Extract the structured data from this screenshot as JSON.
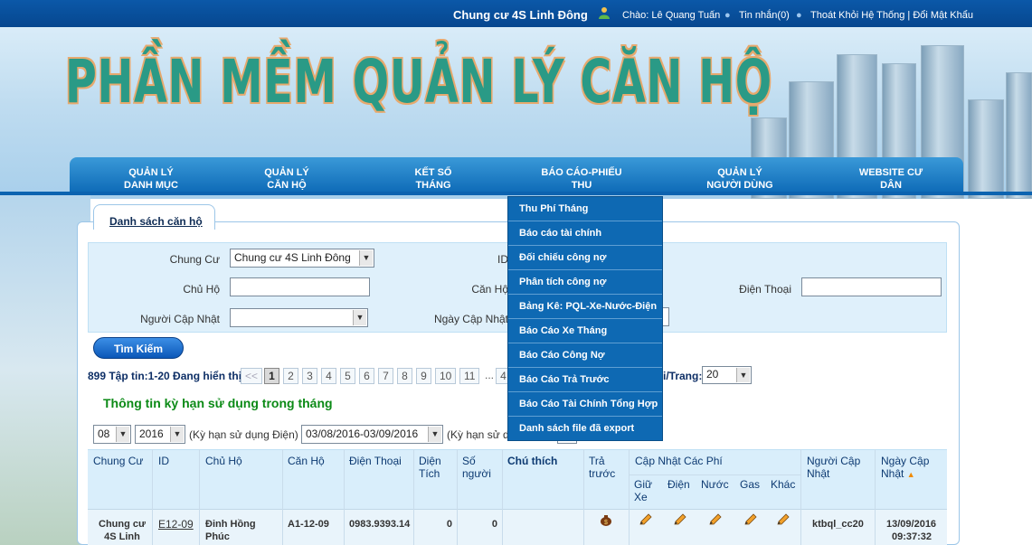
{
  "topbar": {
    "site_name": "Chung cư 4S Linh Đông",
    "greeting": "Chào: Lê Quang Tuấn",
    "messages": "Tin nhắn(0)",
    "links": "Thoát Khỏi Hệ Thống | Đổi Mật Khẩu"
  },
  "banner": {
    "title": "PHẦN MỀM QUẢN LÝ CĂN HỘ"
  },
  "nav": [
    {
      "line1": "QUẢN LÝ",
      "line2": "DANH MỤC"
    },
    {
      "line1": "QUẢN LÝ",
      "line2": "CĂN HỘ"
    },
    {
      "line1": "KẾT SỔ",
      "line2": "THÁNG"
    },
    {
      "line1": "BÁO CÁO-PHIẾU",
      "line2": "THU"
    },
    {
      "line1": "QUẢN LÝ",
      "line2": "NGƯỜI DÙNG"
    },
    {
      "line1": "WEBSITE CƯ",
      "line2": "DÂN"
    }
  ],
  "tab": {
    "label": "Danh sách căn hộ"
  },
  "form": {
    "chung_cu_label": "Chung Cư",
    "chung_cu_value": "Chung cư 4S Linh Đông",
    "id_label": "ID",
    "chu_ho_label": "Chủ Hộ",
    "can_ho_label": "Căn Hộ",
    "dien_thoai_label": "Điện Thoại",
    "nguoi_cap_nhat_label": "Người Cập Nhật",
    "ngay_cap_nhat_label": "Ngày Cập Nhật",
    "search_button": "Tìm Kiếm"
  },
  "pager": {
    "info": "899 Tập tin:1-20 Đang hiển thị",
    "prev": "<<",
    "pages": [
      "1",
      "2",
      "3",
      "4",
      "5",
      "6",
      "7",
      "8",
      "9",
      "10",
      "11",
      "...",
      "4"
    ],
    "per_page_label": "i/Trang:",
    "per_page_value": "20"
  },
  "section": {
    "title": "Thông tin kỳ hạn sử dụng trong tháng",
    "month": "08",
    "year": "2016",
    "ky_han_dien_label": "(Kỳ hạn sử dụng Điện)",
    "ky_han_dien_value": "03/08/2016-03/09/2016",
    "ky_han_label2": "(Kỳ hạn sử d"
  },
  "table": {
    "headers": {
      "chung_cu": "Chung Cư",
      "id": "ID",
      "chu_ho": "Chủ Hộ",
      "can_ho": "Căn Hộ",
      "dien_thoai": "Điện Thoại",
      "dien_tich": "Diện Tích",
      "so_nguoi": "Số người",
      "chu_thich": "Chú thích",
      "tra_truoc": "Trả trước",
      "cap_nhat_cac_phi": "Cập Nhật Các Phí",
      "giu_xe": "Giữ Xe",
      "dien": "Điện",
      "nuoc": "Nước",
      "gas": "Gas",
      "khac": "Khác",
      "nguoi_cap_nhat": "Người Cập Nhật",
      "ngay_cap_nhat": "Ngày Cập Nhật"
    },
    "rows": [
      {
        "chung_cu": "Chung cư 4S Linh",
        "id": "E12-09",
        "chu_ho": "Đinh Hồng Phúc",
        "can_ho": "A1-12-09",
        "dien_thoai": "0983.9393.14",
        "dien_tich": "0",
        "so_nguoi": "0",
        "chu_thich": "",
        "nguoi_cap_nhat": "ktbql_cc20",
        "ngay_cap_nhat_date": "13/09/2016",
        "ngay_cap_nhat_time": "09:37:32"
      }
    ]
  },
  "dropdown": [
    "Thu Phí Tháng",
    "Báo cáo tài chính",
    "Đối chiếu công nợ",
    "Phân tích công nợ",
    "Bảng Kê: PQL-Xe-Nước-Điện",
    "Báo Cáo Xe Tháng",
    "Báo Cáo Công Nợ",
    "Báo Cáo Trả Trước",
    "Báo Cáo Tài Chính Tổng Hợp",
    "Danh sách file đã export"
  ]
}
